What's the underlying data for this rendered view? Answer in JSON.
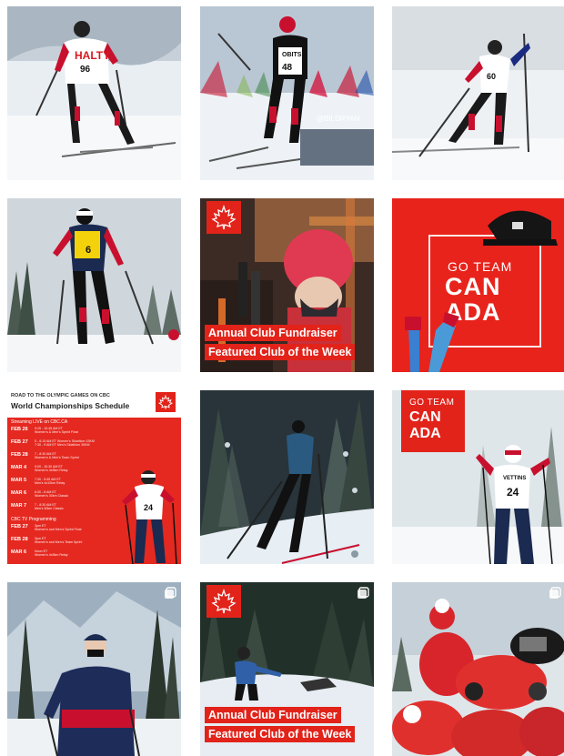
{
  "tiles": [
    {
      "alt": "Skier in HALTY race bib 96 skate skiing"
    },
    {
      "alt": "Skier in bib 48 racing on course"
    },
    {
      "alt": "Skier in bib 60 climbing with poles"
    },
    {
      "alt": "Skier in yellow bib 6 in snowy forest"
    },
    {
      "alt": "Child in red knit hat holding skis",
      "caption_line1": "Annual Club Fundraiser",
      "caption_line2": "Featured Club of the Week"
    },
    {
      "alt": "Socks and cap merchandise",
      "go_small": "GO TEAM",
      "go_line1": "CAN",
      "go_line2": "ADA"
    },
    {
      "alt": "World Championships schedule graphic"
    },
    {
      "alt": "Skier in dark forest at dusk"
    },
    {
      "alt": "Skier in bib 24 racing",
      "go_small": "GO TEAM",
      "go_line1": "CAN",
      "go_line2": "ADA"
    },
    {
      "alt": "Athlete in Canada team jacket with mask"
    },
    {
      "alt": "Child skiing at night",
      "caption_line1": "Annual Club Fundraiser",
      "caption_line2": "Featured Club of the Week"
    },
    {
      "alt": "Team in red jackets celebrating"
    }
  ],
  "watermark": "@BILDRYAN",
  "bibs": {
    "t0": "96",
    "t1": "48",
    "t2": "60",
    "t3": "6",
    "t6": "24",
    "t8": "24"
  },
  "bib_sponsor": {
    "halty": "HALTY",
    "obits": "OBITS",
    "vettins": "VETTINS"
  },
  "schedule": {
    "kicker": "ROAD TO THE OLYMPIC GAMES ON CBC",
    "title": "World Championships Schedule",
    "streaming_label": "Streaming LIVE on CBC.CA",
    "tv_label": "CBC TV Programming",
    "stream_rows": [
      {
        "date": "FEB 26",
        "events": [
          "9:15 - 10:45 AM ET",
          "Women's & Men's Sprint Final"
        ]
      },
      {
        "date": "FEB 27",
        "events": [
          "5 - 6:15 AM ET Women's Skiathlon 15KM",
          "7:30 - 9 AM ET Men's Skiathlon 30KM"
        ]
      },
      {
        "date": "FEB 28",
        "events": [
          "7 - 8:30 AM ET",
          "Women's & Men's Team Sprint"
        ]
      },
      {
        "date": "MAR 4",
        "events": [
          "9:00 - 10:30 AM ET",
          "Women's 4x5km Relay"
        ]
      },
      {
        "date": "MAR 5",
        "events": [
          "7:30 - 9:45 AM ET",
          "Men's 4x10km Relay"
        ]
      },
      {
        "date": "MAR 6",
        "events": [
          "6:30 - 8 AM ET",
          "Women's 30km Classic"
        ]
      },
      {
        "date": "MAR 7",
        "events": [
          "7 - 8:30 AM ET",
          "Men's 50km Classic"
        ]
      }
    ],
    "tv_rows": [
      {
        "date": "FEB 27",
        "events": [
          "3pm ET",
          "Women's and Men's Sprint Final"
        ]
      },
      {
        "date": "FEB 28",
        "events": [
          "3pm ET",
          "Women's and Men's Team Sprint"
        ]
      },
      {
        "date": "MAR 6",
        "events": [
          "Noon ET",
          "Women's 4x5km Relay"
        ]
      }
    ]
  },
  "colors": {
    "brand_red": "#e2231a",
    "white": "#ffffff"
  },
  "icons": {
    "multi": "multi-photo-icon",
    "leaf": "maple-leaf-icon"
  }
}
